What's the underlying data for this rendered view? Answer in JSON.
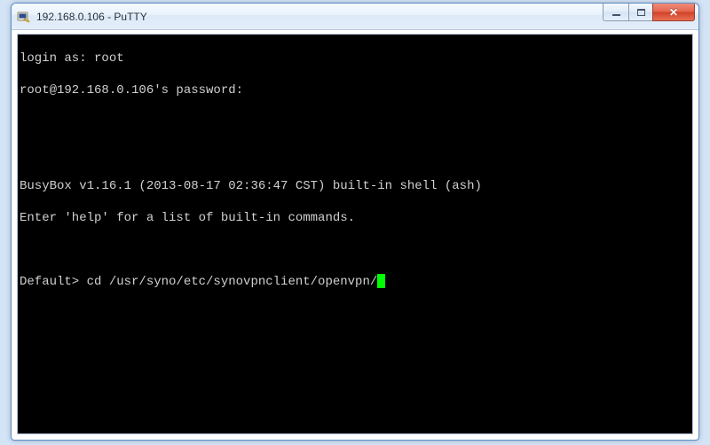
{
  "window": {
    "title": "192.168.0.106 - PuTTY"
  },
  "terminal": {
    "lines": [
      "login as: root",
      "root@192.168.0.106's password:",
      "",
      "",
      "BusyBox v1.16.1 (2013-08-17 02:36:47 CST) built-in shell (ash)",
      "Enter 'help' for a list of built-in commands.",
      ""
    ],
    "prompt_line_prefix": "Default> cd /usr/syno/etc/synovpnclient/openvpn/"
  }
}
